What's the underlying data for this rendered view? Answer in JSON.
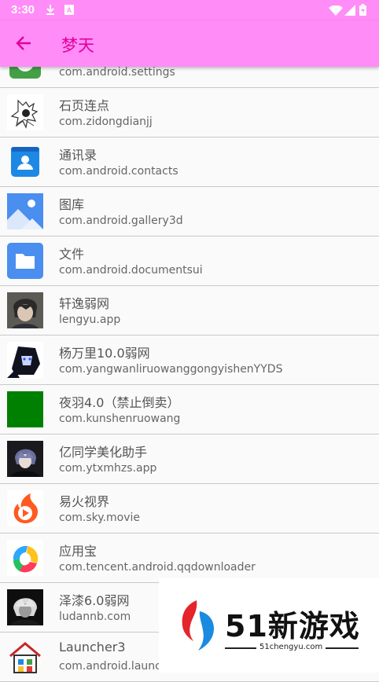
{
  "status_bar": {
    "time": "3:30",
    "icons": [
      "download-icon",
      "text-a-icon",
      "wifi-icon",
      "signal-icon",
      "battery-icon"
    ]
  },
  "app_bar": {
    "back_icon": "arrow-left-icon",
    "title": "梦天"
  },
  "colors": {
    "app_bar": "#ff8cf7",
    "title": "#e1009a",
    "divider": "#c9c9c9"
  },
  "apps": [
    {
      "name": "",
      "package": "com.android.settings",
      "icon": "settings-icon"
    },
    {
      "name": "石页连点",
      "package": "com.zidongdianjj",
      "icon": "sketch-figure-icon"
    },
    {
      "name": "通讯录",
      "package": "com.android.contacts",
      "icon": "contacts-icon"
    },
    {
      "name": "图库",
      "package": "com.android.gallery3d",
      "icon": "gallery-icon"
    },
    {
      "name": "文件",
      "package": "com.android.documentsui",
      "icon": "folder-icon"
    },
    {
      "name": "轩逸弱网",
      "package": "lengyu.app",
      "icon": "anime-avatar-icon"
    },
    {
      "name": "杨万里10.0弱网",
      "package": "com.yangwanliruowanggongyishenYYDS",
      "icon": "anime-avatar-icon"
    },
    {
      "name": "夜羽4.0（禁止倒卖）",
      "package": "com.kunshenruowang",
      "icon": "green-square-icon"
    },
    {
      "name": "亿同学美化助手",
      "package": "com.ytxmhzs.app",
      "icon": "anime-avatar-icon"
    },
    {
      "name": "易火视界",
      "package": "com.sky.movie",
      "icon": "flame-play-icon"
    },
    {
      "name": "应用宝",
      "package": "com.tencent.android.qqdownloader",
      "icon": "yingyongbao-icon"
    },
    {
      "name": "泽漆6.0弱网",
      "package": "ludannb.com",
      "icon": "anime-avatar-icon"
    },
    {
      "name": "Launcher3",
      "package": "com.android.launcher3",
      "icon": "house-icon"
    }
  ],
  "watermark": {
    "title": "51新游戏",
    "url": "51chengyu.com"
  }
}
